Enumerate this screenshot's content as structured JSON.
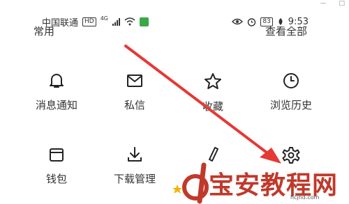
{
  "status_bar": {
    "carrier": "中国联通",
    "hd": "HD",
    "network": "4G",
    "battery": "83",
    "time": "9:53"
  },
  "section": {
    "left_label": "常用",
    "right_label": "查看全部"
  },
  "menu": {
    "row1": [
      {
        "label": "消息通知",
        "icon": "bell-icon"
      },
      {
        "label": "私信",
        "icon": "mail-icon"
      },
      {
        "label": "收藏",
        "icon": "star-icon"
      },
      {
        "label": "浏览历史",
        "icon": "clock-icon"
      }
    ],
    "row2": [
      {
        "label": "钱包",
        "icon": "wallet-icon"
      },
      {
        "label": "下载管理",
        "icon": "download-icon"
      },
      {
        "label": "",
        "icon": "pen-icon"
      },
      {
        "label": "",
        "icon": "gear-icon"
      }
    ]
  },
  "watermark": {
    "text": "宝安教程网",
    "url": "hcjhd.com"
  },
  "colors": {
    "arrow": "#e53935",
    "watermark": "#c0392b"
  }
}
